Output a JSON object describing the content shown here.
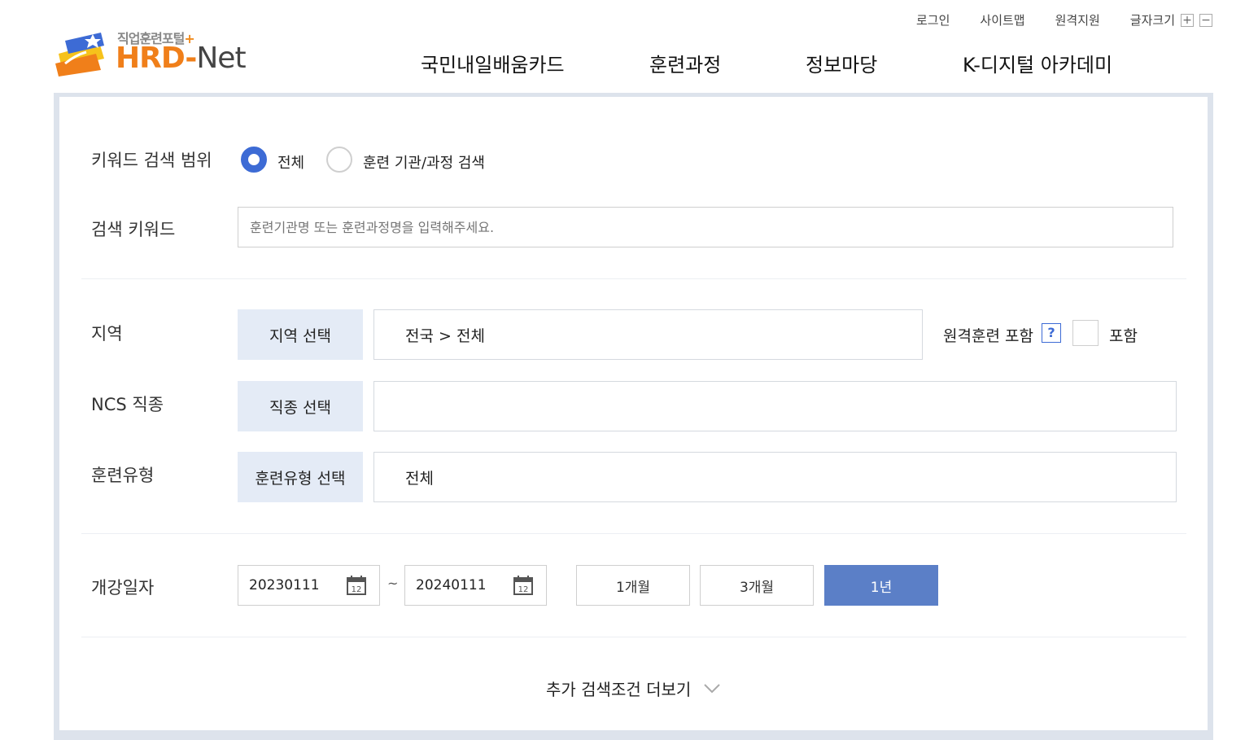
{
  "header": {
    "logo_sub": "직업훈련포털",
    "logo_plus": "+",
    "logo_main": "HRD",
    "logo_dash": "-",
    "logo_net": "Net",
    "util": {
      "login": "로그인",
      "sitemap": "사이트맵",
      "remote_support": "원격지원",
      "font_size": "글자크기",
      "font_plus": "+",
      "font_minus": "−"
    },
    "nav": [
      "국민내일배움카드",
      "훈련과정",
      "정보마당",
      "K-디지털 아카데미"
    ]
  },
  "search": {
    "scope": {
      "label": "키워드 검색 범위",
      "options": [
        "전체",
        "훈련 기관/과정 검색"
      ],
      "selected": "전체"
    },
    "keyword": {
      "label": "검색 키워드",
      "placeholder": "훈련기관명 또는 훈련과정명을 입력해주세요.",
      "value": ""
    },
    "region": {
      "label": "지역",
      "button": "지역 선택",
      "value": "전국 > 전체",
      "remote_label": "원격훈련 포함",
      "help": "?",
      "include_label": "포함",
      "include_checked": false
    },
    "ncs": {
      "label": "NCS 직종",
      "button": "직종 선택",
      "value": ""
    },
    "type": {
      "label": "훈련유형",
      "button": "훈련유형 선택",
      "value": "전체"
    },
    "date": {
      "label": "개강일자",
      "start": "20230111",
      "end": "20240111",
      "separator": "~",
      "calendar_day": "12",
      "periods": [
        "1개월",
        "3개월",
        "1년"
      ],
      "active_period": "1년"
    },
    "more": "추가 검색조건 더보기"
  },
  "colors": {
    "accent": "#3d6bd5",
    "active_button": "#5b7fc7",
    "select_button_bg": "#e4ebf6",
    "logo_orange": "#f07f1a"
  }
}
